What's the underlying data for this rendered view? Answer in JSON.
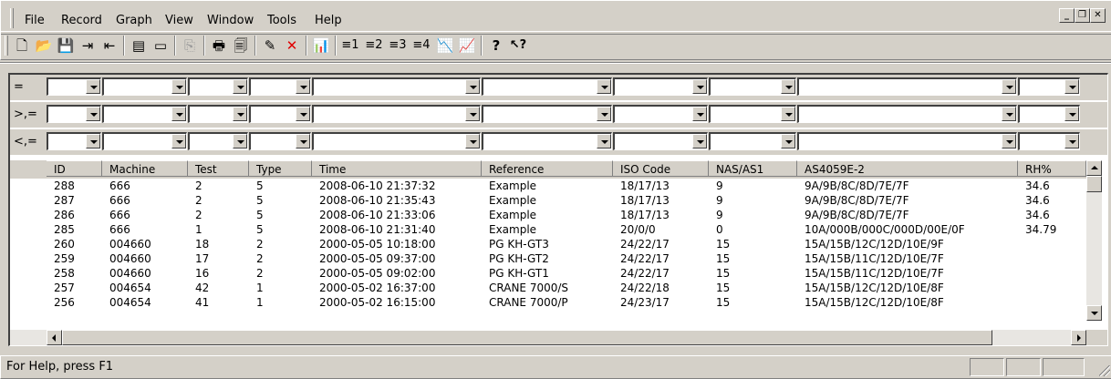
{
  "menu": {
    "items": [
      "File",
      "Record",
      "Graph",
      "View",
      "Window",
      "Tools",
      "Help"
    ]
  },
  "window_buttons": {
    "minimize": "_",
    "restore": "❐",
    "close": "✕"
  },
  "toolbar": {
    "buttons": [
      {
        "name": "new",
        "icon": "new-document-icon",
        "glyph": "🗋"
      },
      {
        "name": "open",
        "icon": "folder-open-icon",
        "glyph": "📂"
      },
      {
        "name": "save",
        "icon": "floppy-disk-icon",
        "glyph": "💾"
      },
      {
        "name": "export",
        "icon": "export-arrow-icon",
        "glyph": "⇥"
      },
      {
        "name": "import",
        "icon": "import-arrow-icon",
        "glyph": "⇤"
      },
      {
        "name": "grid-view",
        "icon": "grid-view-icon",
        "glyph": "▤"
      },
      {
        "name": "form-view",
        "icon": "form-view-icon",
        "glyph": "▭"
      },
      {
        "name": "copy",
        "icon": "copy-icon",
        "glyph": "⎘"
      },
      {
        "name": "print",
        "icon": "printer-icon",
        "glyph": "🖶"
      },
      {
        "name": "print-preview",
        "icon": "print-preview-icon",
        "glyph": "🗐"
      },
      {
        "name": "edit-record",
        "icon": "edit-record-icon",
        "glyph": "✎"
      },
      {
        "name": "delete",
        "icon": "delete-x-icon",
        "glyph": "✕"
      },
      {
        "name": "chart-help",
        "icon": "chart-help-icon",
        "glyph": "📊"
      },
      {
        "name": "list-1",
        "icon": "list-1-icon",
        "glyph": "≡1"
      },
      {
        "name": "list-2",
        "icon": "list-2-icon",
        "glyph": "≡2"
      },
      {
        "name": "list-3",
        "icon": "list-3-icon",
        "glyph": "≡3"
      },
      {
        "name": "list-4",
        "icon": "list-4-icon",
        "glyph": "≡4"
      },
      {
        "name": "graph-lines",
        "icon": "graph-lines-icon",
        "glyph": "📉"
      },
      {
        "name": "graph-area",
        "icon": "graph-area-icon",
        "glyph": "📈"
      },
      {
        "name": "help",
        "icon": "help-question-icon",
        "glyph": "?"
      },
      {
        "name": "context-help",
        "icon": "context-help-arrow-icon",
        "glyph": "↖?"
      }
    ]
  },
  "filters": {
    "operators": [
      "=",
      ">,=",
      "<,="
    ]
  },
  "grid": {
    "columns": [
      "ID",
      "Machine",
      "Test",
      "Type",
      "Time",
      "Reference",
      "ISO Code",
      "NAS/AS1",
      "AS4059E-2",
      "RH%"
    ],
    "rows": [
      [
        "288",
        "666",
        "2",
        "5",
        "2008-06-10 21:37:32",
        "Example",
        "18/17/13",
        "9",
        "9A/9B/8C/8D/7E/7F",
        "34.6"
      ],
      [
        "287",
        "666",
        "2",
        "5",
        "2008-06-10 21:35:43",
        "Example",
        "18/17/13",
        "9",
        "9A/9B/8C/8D/7E/7F",
        "34.6"
      ],
      [
        "286",
        "666",
        "2",
        "5",
        "2008-06-10 21:33:06",
        "Example",
        "18/17/13",
        "9",
        "9A/9B/8C/8D/7E/7F",
        "34.6"
      ],
      [
        "285",
        "666",
        "1",
        "5",
        "2008-06-10 21:31:40",
        "Example",
        "20/0/0",
        "0",
        "10A/000B/000C/000D/00E/0F",
        "34.79"
      ],
      [
        "260",
        "004660",
        "18",
        "2",
        "2000-05-05 10:18:00",
        "PG KH-GT3",
        "24/22/17",
        "15",
        "15A/15B/12C/12D/10E/9F",
        ""
      ],
      [
        "259",
        "004660",
        "17",
        "2",
        "2000-05-05 09:37:00",
        "PG KH-GT2",
        "24/22/17",
        "15",
        "15A/15B/11C/12D/10E/7F",
        ""
      ],
      [
        "258",
        "004660",
        "16",
        "2",
        "2000-05-05 09:02:00",
        "PG KH-GT1",
        "24/22/17",
        "15",
        "15A/15B/11C/12D/10E/7F",
        ""
      ],
      [
        "257",
        "004654",
        "42",
        "1",
        "2000-05-02 16:37:00",
        "CRANE 7000/S",
        "24/22/18",
        "15",
        "15A/15B/12C/12D/10E/8F",
        ""
      ],
      [
        "256",
        "004654",
        "41",
        "1",
        "2000-05-02 16:15:00",
        "CRANE 7000/P",
        "24/23/17",
        "15",
        "15A/15B/12C/12D/10E/8F",
        ""
      ]
    ]
  },
  "status": {
    "text": "For Help, press F1"
  }
}
